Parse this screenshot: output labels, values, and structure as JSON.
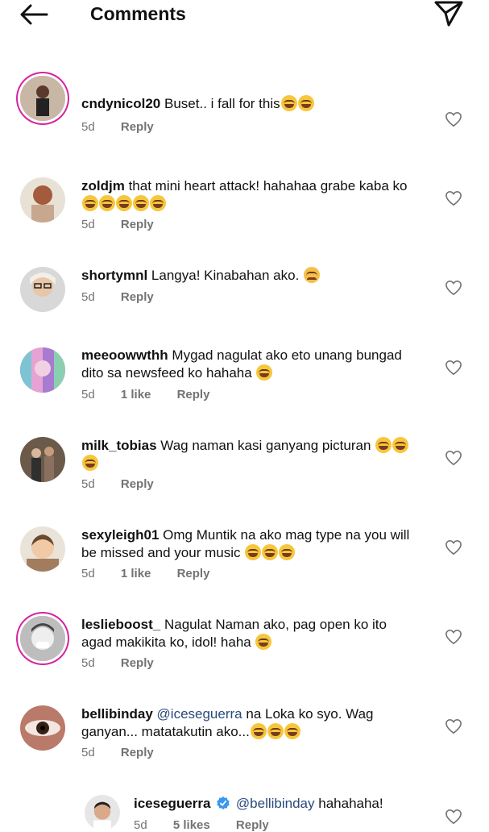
{
  "header": {
    "title": "Comments"
  },
  "comments": [
    {
      "user": "cndynicol20",
      "text": "Buset.. i fall for this",
      "emoji": [
        "laugh",
        "laugh"
      ],
      "time": "5d",
      "likes": "",
      "reply": "Reply"
    },
    {
      "user": "zoldjm",
      "text": "that mini heart attack! hahahaa grabe kaba ko",
      "emoji": [
        "laugh",
        "laugh",
        "laugh",
        "laugh",
        "laugh"
      ],
      "time": "5d",
      "likes": "",
      "reply": "Reply"
    },
    {
      "user": "shortymnl",
      "text": "Langya! Kinabahan ako.",
      "emoji": [
        "sad"
      ],
      "time": "5d",
      "likes": "",
      "reply": "Reply"
    },
    {
      "user": "meeoowwthh",
      "text": "Mygad nagulat ako eto unang bungad dito sa newsfeed ko hahaha",
      "emoji": [
        "laugh"
      ],
      "time": "5d",
      "likes": "1 like",
      "reply": "Reply"
    },
    {
      "user": "milk_tobias",
      "text": "Wag naman kasi ganyang picturan",
      "emoji": [
        "laugh",
        "laugh",
        "laugh"
      ],
      "time": "5d",
      "likes": "",
      "reply": "Reply"
    },
    {
      "user": "sexyleigh01",
      "text": "Omg Muntik na ako mag type na you will be missed and your music",
      "emoji": [
        "laugh",
        "laugh",
        "laugh"
      ],
      "time": "5d",
      "likes": "1 like",
      "reply": "Reply"
    },
    {
      "user": "leslieboost_",
      "text": "Nagulat Naman ako, pag open ko ito agad makikita ko, idol! haha",
      "emoji": [
        "grin"
      ],
      "time": "5d",
      "likes": "",
      "reply": "Reply"
    },
    {
      "user": "bellibinday",
      "mention": "@iceseguerra",
      "text": "na Loka ko syo. Wag ganyan... matatakutin ako...",
      "emoji": [
        "laugh",
        "laugh",
        "laugh"
      ],
      "time": "5d",
      "likes": "",
      "reply": "Reply"
    }
  ],
  "reply": {
    "user": "iceseguerra",
    "mention": "@bellibinday",
    "text": "hahahaha!",
    "time": "5d",
    "likes": "5 likes",
    "reply": "Reply"
  },
  "colors": {
    "ring": "#d6249f",
    "mention": "#2a4a7a",
    "meta": "#737373"
  }
}
